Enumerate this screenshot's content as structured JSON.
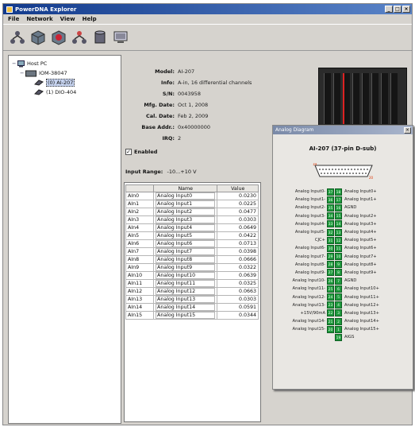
{
  "window": {
    "title": "PowerDNA Explorer",
    "controls": [
      "_",
      "□",
      "×"
    ]
  },
  "menu": [
    "File",
    "Network",
    "View",
    "Help"
  ],
  "toolbar": [
    {
      "icon": "network-find-icon"
    },
    {
      "icon": "cube-icon"
    },
    {
      "icon": "cube-red-icon"
    },
    {
      "icon": "network-add-icon"
    },
    {
      "icon": "cylinder-icon"
    },
    {
      "icon": "screen-icon"
    }
  ],
  "tree": {
    "root": "Host PC",
    "ioc": "IOM-38047",
    "dev1": "(0) AI-207",
    "dev2": "(1) DIO-404"
  },
  "props": [
    {
      "k": "Model:",
      "v": "AI-207"
    },
    {
      "k": "Info:",
      "v": "A-in, 16 differential channels"
    },
    {
      "k": "S/N:",
      "v": "0043958"
    },
    {
      "k": "Mfg. Date:",
      "v": "Oct 1, 2008"
    },
    {
      "k": "Cal. Date:",
      "v": "Feb 2, 2009"
    },
    {
      "k": "Base Addr.:",
      "v": "0x40000000"
    },
    {
      "k": "IRQ:",
      "v": "2"
    }
  ],
  "enabled_label": "Enabled",
  "range": {
    "label": "Input Range:",
    "value": "-10...+10 V"
  },
  "table": {
    "headers": [
      "",
      "Name",
      "Value"
    ],
    "rows": [
      [
        "AIn0",
        "Analog Input0",
        "0.0230"
      ],
      [
        "AIn1",
        "Analog Input1",
        "0.0225"
      ],
      [
        "AIn2",
        "Analog Input2",
        "0.0477"
      ],
      [
        "AIn3",
        "Analog Input3",
        "0.0303"
      ],
      [
        "AIn4",
        "Analog Input4",
        "0.0649"
      ],
      [
        "AIn5",
        "Analog Input5",
        "0.0422"
      ],
      [
        "AIn6",
        "Analog Input6",
        "0.0713"
      ],
      [
        "AIn7",
        "Analog Input7",
        "0.0398"
      ],
      [
        "AIn8",
        "Analog Input8",
        "0.0666"
      ],
      [
        "AIn9",
        "Analog Input9",
        "0.0322"
      ],
      [
        "AIn10",
        "Analog Input10",
        "0.0639"
      ],
      [
        "AIn11",
        "Analog Input11",
        "0.0325"
      ],
      [
        "AIn12",
        "Analog Input12",
        "0.0663"
      ],
      [
        "AIn13",
        "Analog Input13",
        "0.0303"
      ],
      [
        "AIn14",
        "Analog Input14",
        "0.0591"
      ],
      [
        "AIn15",
        "Analog Input15",
        "0.0344"
      ]
    ]
  },
  "popup": {
    "title": "Analog Diagram",
    "heading": "AI-207 (37-pin D-sub)",
    "conn_left": "19",
    "conn_right": "20",
    "pins": [
      {
        "l": "Analog Input0-",
        "a": "37",
        "b": "18",
        "r": "Analog Input0+"
      },
      {
        "l": "Analog Input1-",
        "a": "36",
        "b": "17",
        "r": "Analog Input1+"
      },
      {
        "l": "Analog Input2-",
        "a": "35",
        "b": "16",
        "r": "AGND"
      },
      {
        "l": "Analog Input3-",
        "a": "34",
        "b": "15",
        "r": "Analog Input2+"
      },
      {
        "l": "Analog Input4-",
        "a": "33",
        "b": "14",
        "r": "Analog Input3+"
      },
      {
        "l": "Analog Input5-",
        "a": "32",
        "b": "13",
        "r": "Analog Input4+"
      },
      {
        "l": "CJC+",
        "a": "31",
        "b": "12",
        "r": "Analog Input5+"
      },
      {
        "l": "Analog Input6-",
        "a": "30",
        "b": "11",
        "r": "Analog Input6+"
      },
      {
        "l": "Analog Input7-",
        "a": "29",
        "b": "10",
        "r": "Analog Input7+"
      },
      {
        "l": "Analog Input8-",
        "a": "28",
        "b": "9",
        "r": "Analog Input8+"
      },
      {
        "l": "Analog Input9-",
        "a": "27",
        "b": "8",
        "r": "Analog Input9+"
      },
      {
        "l": "Analog Input10-",
        "a": "26",
        "b": "7",
        "r": "AGND"
      },
      {
        "l": "Analog Input11-",
        "a": "25",
        "b": "6",
        "r": "Analog Input10+"
      },
      {
        "l": "Analog Input12-",
        "a": "24",
        "b": "5",
        "r": "Analog Input11+"
      },
      {
        "l": "Analog Input13-",
        "a": "23",
        "b": "4",
        "r": "Analog Input12+"
      },
      {
        "l": "+15V/90mA",
        "a": "22",
        "b": "3",
        "r": "Analog Input13+"
      },
      {
        "l": "Analog Input14-",
        "a": "21",
        "b": "2",
        "r": "Analog Input14+"
      },
      {
        "l": "Analog Input15-",
        "a": "20",
        "b": "1",
        "r": "Analog Input15+"
      },
      {
        "l": "",
        "a": "",
        "b": "19",
        "r": "AIGS"
      }
    ]
  }
}
